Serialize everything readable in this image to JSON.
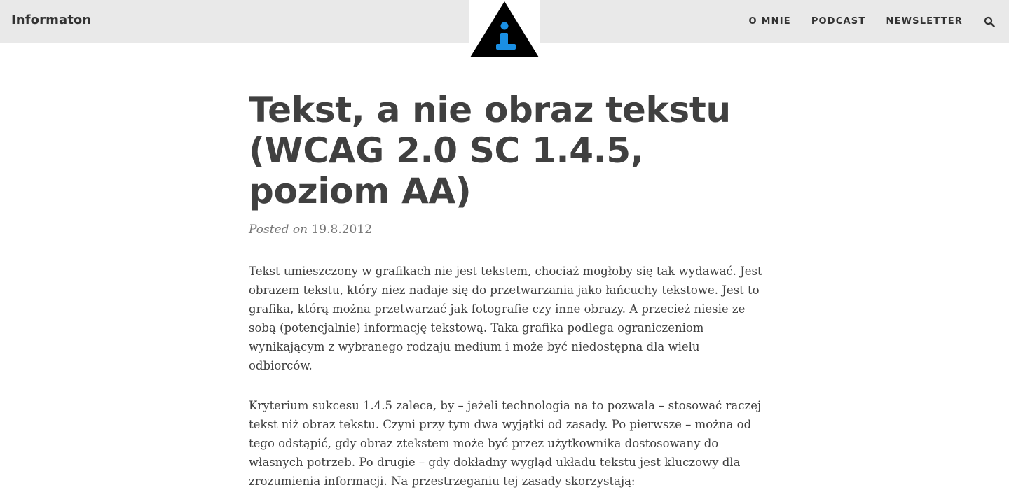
{
  "header": {
    "brand": "Informaton",
    "logo_icon": "info-triangle-logo",
    "logo_letter": "i",
    "nav": [
      {
        "label": "O MNIE"
      },
      {
        "label": "PODCAST"
      },
      {
        "label": "NEWSLETTER"
      }
    ],
    "search_icon": "search-icon"
  },
  "post": {
    "title": "Tekst, a nie obraz tekstu (WCAG 2.0 SC 1.4.5, poziom AA)",
    "posted_prefix": "Posted on",
    "date": "19.8.2012",
    "paragraphs": [
      "Tekst umieszczony w grafikach nie jest tekstem, chociaż mogłoby się tak wydawać. Jest obrazem tekstu, który niez nadaje się do przetwarzania jako łańcuchy tekstowe. Jest to grafika, którą można przetwarzać jak fotografie czy inne obrazy. A przecież niesie ze sobą (potencjalnie) informację tekstową. Taka grafika podlega ograniczeniom wynikającym z wybranego rodzaju medium i może być niedostępna dla wielu odbiorców.",
      "Kryterium sukcesu 1.4.5 zaleca, by – jeżeli technologia na to pozwala – stosować raczej tekst niż obraz tekstu. Czyni przy tym dwa wyjątki od zasady. Po pierwsze – można od tego odstąpić, gdy obraz ztekstem może być przez użytkownika dostosowany do własnych potrzeb. Po drugie – gdy dokładny wygląd układu tekstu jest kluczowy dla zrozumienia informacji. Na przestrzeganiu tej zasady skorzystają:"
    ]
  },
  "colors": {
    "header_bg": "#e9e9e9",
    "text": "#404040",
    "meta": "#767676",
    "logo_triangle": "#000000",
    "logo_letter": "#1a8fe3"
  }
}
